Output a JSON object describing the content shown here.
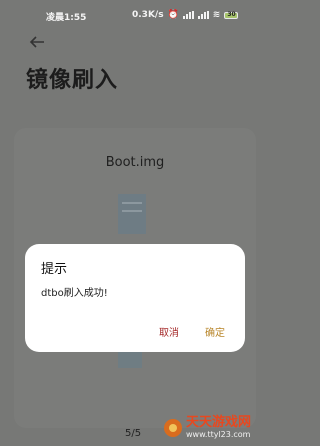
{
  "status_bar": {
    "time": "凌晨1:55",
    "network_speed": "0.3K/s",
    "signal_label_1": "5G",
    "signal_label_2": "5G",
    "battery": "30"
  },
  "header": {
    "title": "镜像刷入"
  },
  "content": {
    "image_title": "Boot.img",
    "pager": "5/5"
  },
  "dialog": {
    "title": "提示",
    "message": "dtbo刷入成功!",
    "cancel_label": "取消",
    "ok_label": "确定"
  },
  "watermark": {
    "name": "天天游戏网",
    "url": "www.ttyl23.com"
  },
  "colors": {
    "dimmed_background": "#777876",
    "dialog_background": "#ffffff",
    "cancel_color": "#a52a2a",
    "ok_color": "#b8862a"
  }
}
